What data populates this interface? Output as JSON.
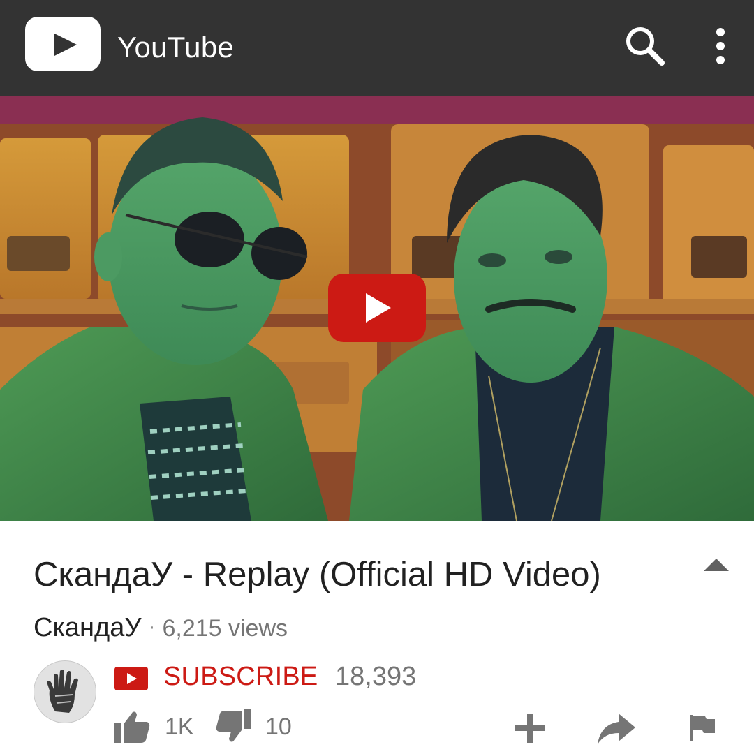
{
  "appbar": {
    "title": "YouTube",
    "background_color": "#333333",
    "icons": [
      "youtube-logo-icon",
      "search-icon",
      "more-vert-icon"
    ]
  },
  "video": {
    "title": "СкандаУ - Replay (Official HD Video)",
    "channel": "СкандаУ",
    "separator": "·",
    "views": "6,215 views",
    "play_button_color": "#cc1a14"
  },
  "channel": {
    "subscribe_label": "SUBSCRIBE",
    "subscriber_count": "18,393",
    "accent_color": "#cc1a14"
  },
  "actions": {
    "likes": "1K",
    "dislikes": "10",
    "icons": [
      "thumb-up-icon",
      "thumb-down-icon",
      "add-to-playlist-icon",
      "share-icon",
      "flag-icon"
    ]
  }
}
